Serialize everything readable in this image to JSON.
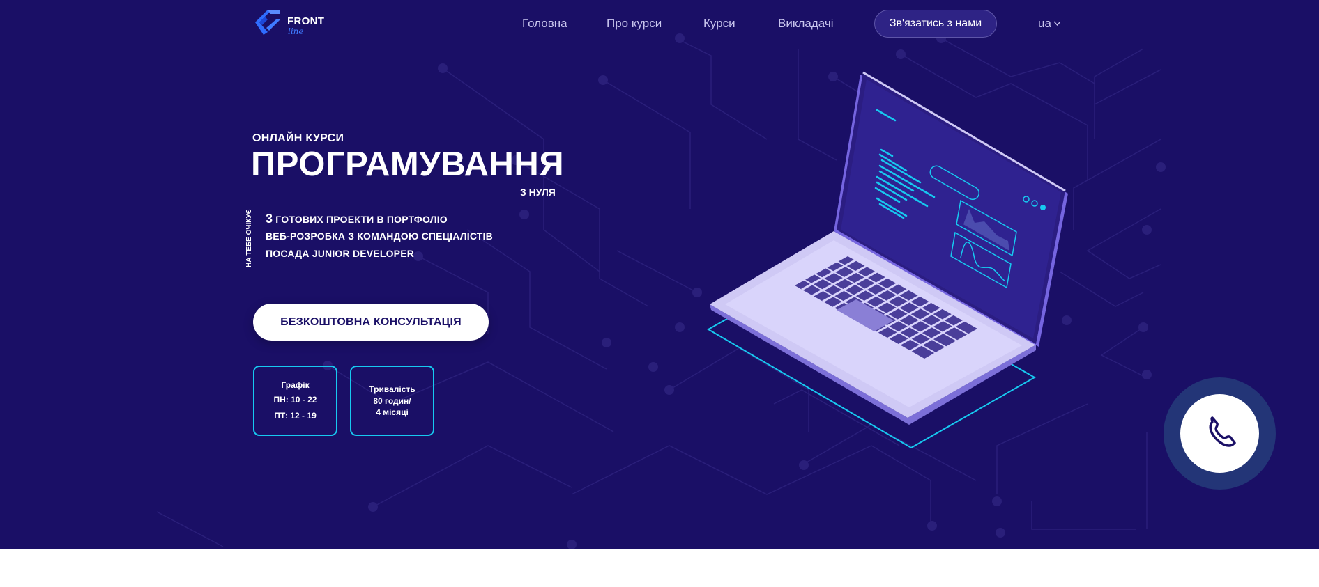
{
  "header": {
    "logo": {
      "name": "FRONT",
      "sub": "line"
    },
    "nav": [
      "Головна",
      "Про курси",
      "Курси",
      "Викладачі"
    ],
    "contact_button": "Зв'язатись з нами",
    "language": "ua"
  },
  "hero": {
    "subtitle": "ОНЛАЙН КУРСИ",
    "title": "ПРОГРАМУВАННЯ",
    "title_suffix": "З НУЛЯ",
    "side_label": "НА ТЕБЕ ОЧІКУЄ",
    "features": {
      "f1_number": "3",
      "f1_text": " ГОТОВИХ ПРОЕКТИ В ПОРТФОЛІО",
      "f2": "ВЕБ-РОЗРОБКА З КОМАНДОЮ СПЕЦІАЛІСТІВ",
      "f3": "ПОСАДА JUNIOR DEVELOPER"
    },
    "cta": "БЕЗКОШТОВНА КОНСУЛЬТАЦІЯ"
  },
  "cards": {
    "schedule": {
      "title": "Графік",
      "line1": "ПН: 10 - 22",
      "line2": "ПТ: 12 - 19"
    },
    "duration": {
      "title": "Тривалість",
      "line1": "80 годин/",
      "line2": "4 місяці"
    }
  },
  "icons": {
    "logo": "frontline-logo-icon",
    "chevron": "chevron-down-icon",
    "phone": "phone-icon",
    "laptop": "laptop-illustration"
  },
  "colors": {
    "background": "#1a0f66",
    "accent_cyan": "#17c9f0",
    "logo_blue": "#3f7bff",
    "call_ring": "#233577"
  }
}
